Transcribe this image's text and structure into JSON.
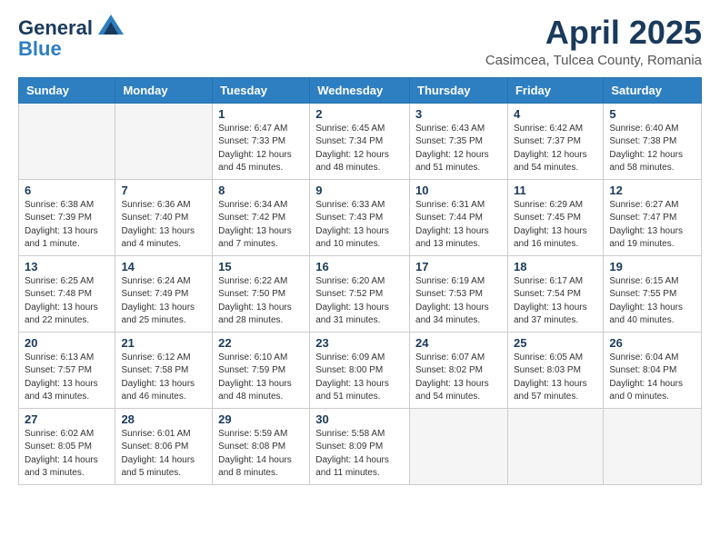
{
  "logo": {
    "general": "General",
    "blue": "Blue"
  },
  "title": "April 2025",
  "subtitle": "Casimcea, Tulcea County, Romania",
  "days_of_week": [
    "Sunday",
    "Monday",
    "Tuesday",
    "Wednesday",
    "Thursday",
    "Friday",
    "Saturday"
  ],
  "weeks": [
    [
      {
        "num": "",
        "detail": ""
      },
      {
        "num": "",
        "detail": ""
      },
      {
        "num": "1",
        "detail": "Sunrise: 6:47 AM\nSunset: 7:33 PM\nDaylight: 12 hours\nand 45 minutes."
      },
      {
        "num": "2",
        "detail": "Sunrise: 6:45 AM\nSunset: 7:34 PM\nDaylight: 12 hours\nand 48 minutes."
      },
      {
        "num": "3",
        "detail": "Sunrise: 6:43 AM\nSunset: 7:35 PM\nDaylight: 12 hours\nand 51 minutes."
      },
      {
        "num": "4",
        "detail": "Sunrise: 6:42 AM\nSunset: 7:37 PM\nDaylight: 12 hours\nand 54 minutes."
      },
      {
        "num": "5",
        "detail": "Sunrise: 6:40 AM\nSunset: 7:38 PM\nDaylight: 12 hours\nand 58 minutes."
      }
    ],
    [
      {
        "num": "6",
        "detail": "Sunrise: 6:38 AM\nSunset: 7:39 PM\nDaylight: 13 hours\nand 1 minute."
      },
      {
        "num": "7",
        "detail": "Sunrise: 6:36 AM\nSunset: 7:40 PM\nDaylight: 13 hours\nand 4 minutes."
      },
      {
        "num": "8",
        "detail": "Sunrise: 6:34 AM\nSunset: 7:42 PM\nDaylight: 13 hours\nand 7 minutes."
      },
      {
        "num": "9",
        "detail": "Sunrise: 6:33 AM\nSunset: 7:43 PM\nDaylight: 13 hours\nand 10 minutes."
      },
      {
        "num": "10",
        "detail": "Sunrise: 6:31 AM\nSunset: 7:44 PM\nDaylight: 13 hours\nand 13 minutes."
      },
      {
        "num": "11",
        "detail": "Sunrise: 6:29 AM\nSunset: 7:45 PM\nDaylight: 13 hours\nand 16 minutes."
      },
      {
        "num": "12",
        "detail": "Sunrise: 6:27 AM\nSunset: 7:47 PM\nDaylight: 13 hours\nand 19 minutes."
      }
    ],
    [
      {
        "num": "13",
        "detail": "Sunrise: 6:25 AM\nSunset: 7:48 PM\nDaylight: 13 hours\nand 22 minutes."
      },
      {
        "num": "14",
        "detail": "Sunrise: 6:24 AM\nSunset: 7:49 PM\nDaylight: 13 hours\nand 25 minutes."
      },
      {
        "num": "15",
        "detail": "Sunrise: 6:22 AM\nSunset: 7:50 PM\nDaylight: 13 hours\nand 28 minutes."
      },
      {
        "num": "16",
        "detail": "Sunrise: 6:20 AM\nSunset: 7:52 PM\nDaylight: 13 hours\nand 31 minutes."
      },
      {
        "num": "17",
        "detail": "Sunrise: 6:19 AM\nSunset: 7:53 PM\nDaylight: 13 hours\nand 34 minutes."
      },
      {
        "num": "18",
        "detail": "Sunrise: 6:17 AM\nSunset: 7:54 PM\nDaylight: 13 hours\nand 37 minutes."
      },
      {
        "num": "19",
        "detail": "Sunrise: 6:15 AM\nSunset: 7:55 PM\nDaylight: 13 hours\nand 40 minutes."
      }
    ],
    [
      {
        "num": "20",
        "detail": "Sunrise: 6:13 AM\nSunset: 7:57 PM\nDaylight: 13 hours\nand 43 minutes."
      },
      {
        "num": "21",
        "detail": "Sunrise: 6:12 AM\nSunset: 7:58 PM\nDaylight: 13 hours\nand 46 minutes."
      },
      {
        "num": "22",
        "detail": "Sunrise: 6:10 AM\nSunset: 7:59 PM\nDaylight: 13 hours\nand 48 minutes."
      },
      {
        "num": "23",
        "detail": "Sunrise: 6:09 AM\nSunset: 8:00 PM\nDaylight: 13 hours\nand 51 minutes."
      },
      {
        "num": "24",
        "detail": "Sunrise: 6:07 AM\nSunset: 8:02 PM\nDaylight: 13 hours\nand 54 minutes."
      },
      {
        "num": "25",
        "detail": "Sunrise: 6:05 AM\nSunset: 8:03 PM\nDaylight: 13 hours\nand 57 minutes."
      },
      {
        "num": "26",
        "detail": "Sunrise: 6:04 AM\nSunset: 8:04 PM\nDaylight: 14 hours\nand 0 minutes."
      }
    ],
    [
      {
        "num": "27",
        "detail": "Sunrise: 6:02 AM\nSunset: 8:05 PM\nDaylight: 14 hours\nand 3 minutes."
      },
      {
        "num": "28",
        "detail": "Sunrise: 6:01 AM\nSunset: 8:06 PM\nDaylight: 14 hours\nand 5 minutes."
      },
      {
        "num": "29",
        "detail": "Sunrise: 5:59 AM\nSunset: 8:08 PM\nDaylight: 14 hours\nand 8 minutes."
      },
      {
        "num": "30",
        "detail": "Sunrise: 5:58 AM\nSunset: 8:09 PM\nDaylight: 14 hours\nand 11 minutes."
      },
      {
        "num": "",
        "detail": ""
      },
      {
        "num": "",
        "detail": ""
      },
      {
        "num": "",
        "detail": ""
      }
    ]
  ]
}
